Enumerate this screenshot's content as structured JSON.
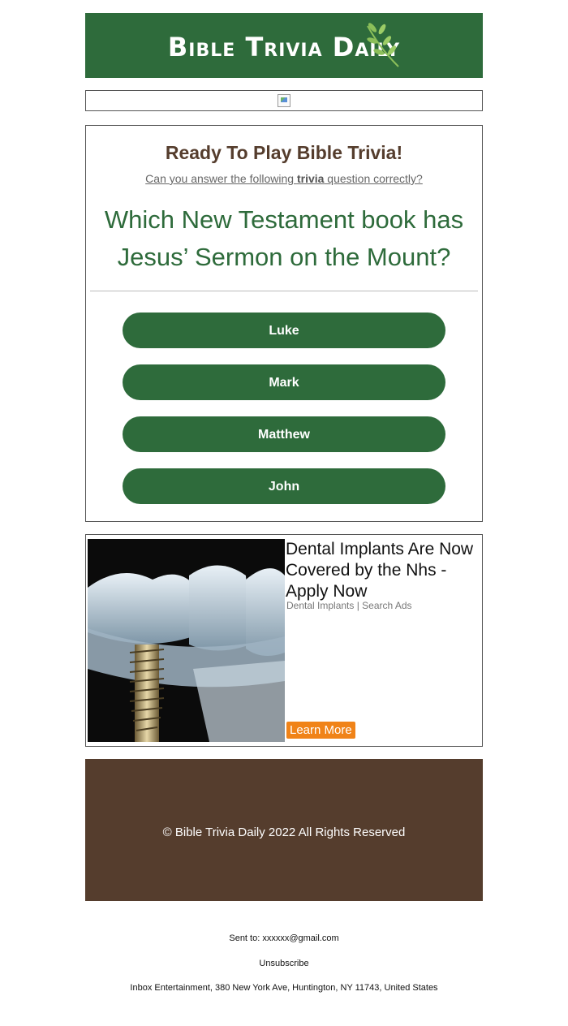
{
  "header": {
    "logo_text": "Bible Trivia Daily",
    "brand_color": "#2e6b3b",
    "logo_icon": "leaf-branch-icon"
  },
  "banner_image": {
    "icon": "broken-image-icon"
  },
  "trivia": {
    "heading": "Ready To Play Bible Trivia!",
    "sub_prefix": "Can you answer the following ",
    "sub_bold": "trivia",
    "sub_suffix": " question correctly?",
    "question": "Which New Testament book has Jesus’ Sermon on the Mount?",
    "answers": [
      "Luke",
      "Mark",
      "Matthew",
      "John"
    ]
  },
  "ad": {
    "title": "Dental Implants Are Now Covered by the Nhs - Apply Now",
    "source": "Dental Implants | Search Ads",
    "button_label": "Learn More",
    "button_color": "#f08318",
    "image": "dental-implant-icon"
  },
  "footer": {
    "copyright": "© Bible Trivia Daily 2022 All Rights Reserved",
    "background": "#553d2d"
  },
  "meta": {
    "sent_to": "Sent to: xxxxxx@gmail.com",
    "unsubscribe": "Unsubscribe",
    "address": "Inbox Entertainment, 380 New York Ave, Huntington, NY 11743, United States"
  }
}
